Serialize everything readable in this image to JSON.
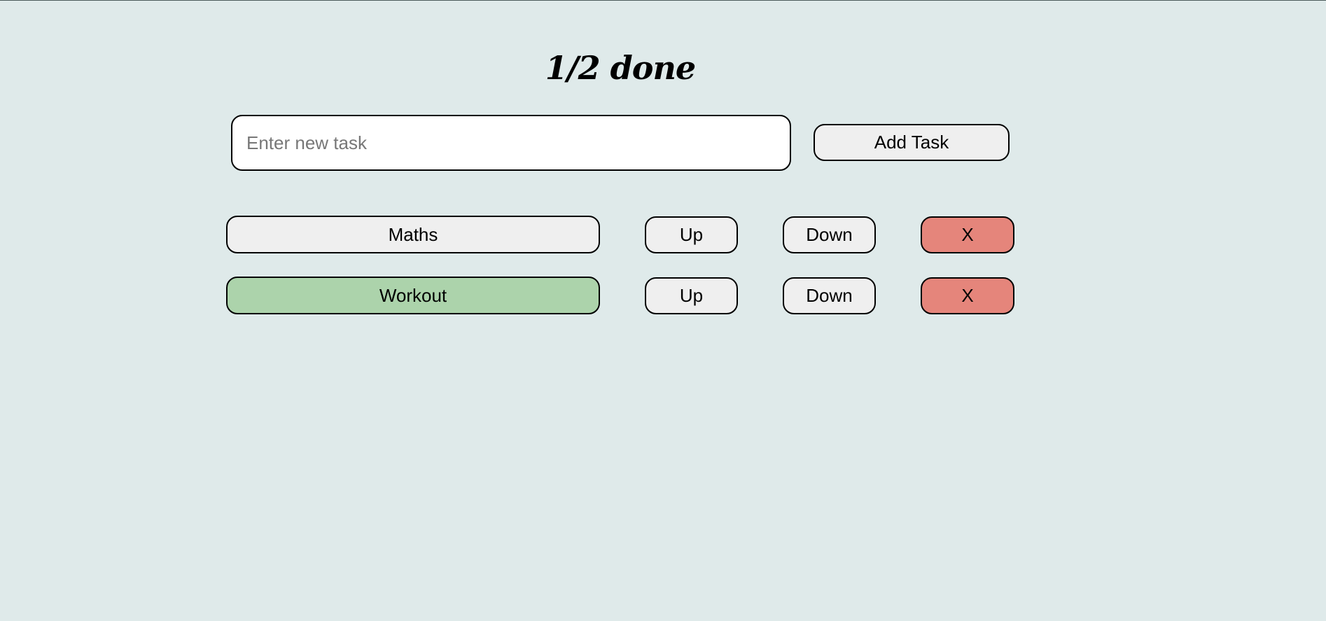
{
  "header": {
    "title": "1/2 done"
  },
  "new_task": {
    "placeholder": "Enter new task",
    "value": "",
    "add_label": "Add Task"
  },
  "tasks": [
    {
      "name": "Maths",
      "done": false,
      "up_label": "Up",
      "down_label": "Down",
      "delete_label": "X"
    },
    {
      "name": "Workout",
      "done": true,
      "up_label": "Up",
      "down_label": "Down",
      "delete_label": "X"
    }
  ],
  "colors": {
    "background": "#dfeaea",
    "button": "#efefef",
    "done_task": "#acd3ab",
    "delete_button": "#e5857b"
  }
}
